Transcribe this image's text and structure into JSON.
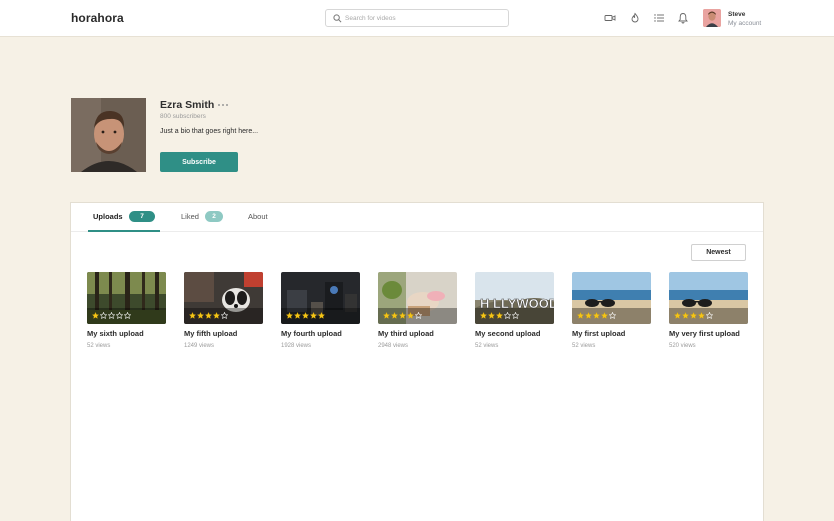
{
  "app": {
    "logo": "horahora"
  },
  "search": {
    "placeholder": "Search for videos"
  },
  "header_icons": [
    "video-camera-icon",
    "fire-icon",
    "list-icon",
    "bell-icon"
  ],
  "user": {
    "name": "Steve",
    "subtitle": "My account"
  },
  "profile": {
    "name": "Ezra Smith",
    "subscribers": "800 subscribers",
    "bio": "Just a bio that goes right here...",
    "subscribe_label": "Subscribe"
  },
  "tabs": [
    {
      "label": "Uploads",
      "count": "7"
    },
    {
      "label": "Liked",
      "count": "2"
    },
    {
      "label": "About"
    }
  ],
  "sort_label": "Newest",
  "videos": [
    {
      "title": "My sixth upload",
      "views": "52 views",
      "rating": 1,
      "scene": "forest"
    },
    {
      "title": "My fifth upload",
      "views": "1249 views",
      "rating": 4,
      "scene": "dog"
    },
    {
      "title": "My fourth upload",
      "views": "1928 views",
      "rating": 5,
      "scene": "studio"
    },
    {
      "title": "My third upload",
      "views": "2948 views",
      "rating": 4,
      "scene": "plant"
    },
    {
      "title": "My second upload",
      "views": "52 views",
      "rating": 3,
      "scene": "hollywood"
    },
    {
      "title": "My first upload",
      "views": "52 views",
      "rating": 4,
      "scene": "beach"
    },
    {
      "title": "My very first upload",
      "views": "520 views",
      "rating": 4,
      "scene": "beach"
    }
  ],
  "colors": {
    "accent": "#2f8f86",
    "liked_badge": "#8ec9c3",
    "background": "#f6f1e6",
    "star": "#f5c518"
  }
}
